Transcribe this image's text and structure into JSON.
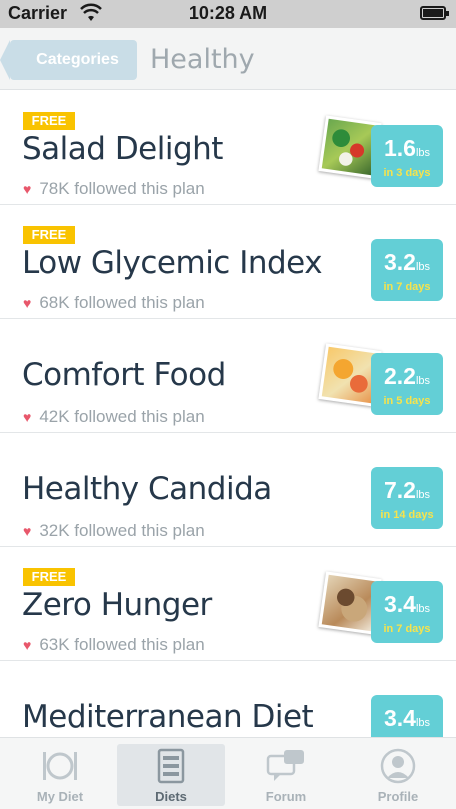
{
  "status_bar": {
    "carrier": "Carrier",
    "time": "10:28 AM"
  },
  "nav": {
    "back_label": "Categories",
    "title": "Healthy"
  },
  "plans": [
    {
      "free": true,
      "free_label": "FREE",
      "title": "Salad Delight",
      "followers": "78K followed this plan",
      "weight": "1.6",
      "unit": "lbs",
      "duration": "in 3 days",
      "photo": "salad-photo"
    },
    {
      "free": true,
      "free_label": "FREE",
      "title": "Low Glycemic Index",
      "followers": "68K followed this plan",
      "weight": "3.2",
      "unit": "lbs",
      "duration": "in 7 days",
      "photo": null
    },
    {
      "free": false,
      "free_label": "",
      "title": "Comfort Food",
      "followers": "42K followed this plan",
      "weight": "2.2",
      "unit": "lbs",
      "duration": "in 5 days",
      "photo": "comfort-food-photo"
    },
    {
      "free": false,
      "free_label": "",
      "title": "Healthy Candida",
      "followers": "32K followed this plan",
      "weight": "7.2",
      "unit": "lbs",
      "duration": "in 14 days",
      "photo": null
    },
    {
      "free": true,
      "free_label": "FREE",
      "title": "Zero Hunger",
      "followers": "63K followed this plan",
      "weight": "3.4",
      "unit": "lbs",
      "duration": "in 7 days",
      "photo": "zero-hunger-photo"
    },
    {
      "free": false,
      "free_label": "",
      "title": "Mediterranean Diet",
      "followers": "",
      "weight": "3.4",
      "unit": "lbs",
      "duration": "",
      "photo": null
    }
  ],
  "tabs": [
    {
      "label": "My Diet",
      "icon": "plate-icon",
      "active": false
    },
    {
      "label": "Diets",
      "icon": "list-icon",
      "active": true
    },
    {
      "label": "Forum",
      "icon": "chat-icon",
      "active": false
    },
    {
      "label": "Profile",
      "icon": "person-icon",
      "active": false
    }
  ],
  "colors": {
    "accent_teal": "#63cfd6",
    "free_yellow": "#f9c300",
    "heart_red": "#e8576b",
    "duration_yellow": "#f7e34c"
  }
}
